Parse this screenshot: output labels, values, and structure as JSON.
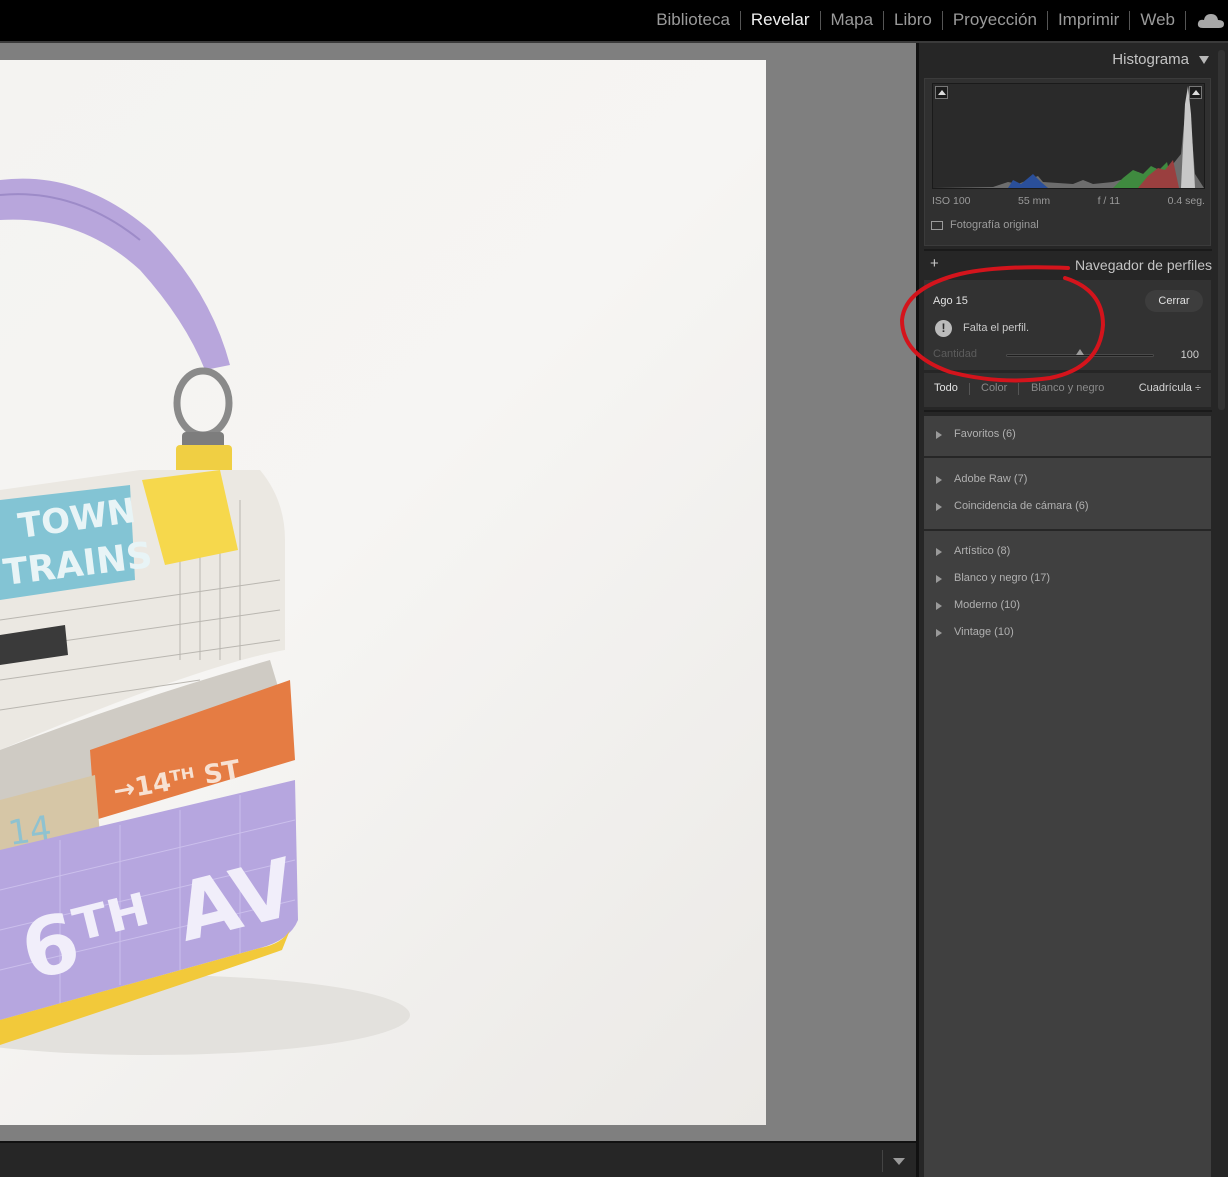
{
  "topbar": {
    "modules": [
      "Biblioteca",
      "Revelar",
      "Mapa",
      "Libro",
      "Proyección",
      "Imprimir",
      "Web"
    ],
    "active_module": "Revelar"
  },
  "histogram": {
    "title": "Histograma",
    "iso": "ISO 100",
    "focal": "55 mm",
    "aperture": "f / 11",
    "shutter": "0.4 seg.",
    "original_photo_label": "Fotografía original"
  },
  "profile_browser": {
    "title": "Navegador de perfiles",
    "profile_name": "Ago 15",
    "close_label": "Cerrar",
    "warning": "Falta el perfil.",
    "amount_label": "Cantidad",
    "amount_value": "100",
    "amount_fraction": 0.5,
    "filters": [
      "Todo",
      "Color",
      "Blanco y negro"
    ],
    "active_filter": "Todo",
    "view_mode": "Cuadrícula ÷",
    "groups": [
      [
        "Favoritos (6)"
      ],
      [
        "Adobe Raw (7)",
        "Coincidencia de cámara (6)"
      ],
      [
        "Artístico (8)",
        "Blanco y negro (17)",
        "Moderno (10)",
        "Vintage (10)"
      ]
    ]
  },
  "colors": {
    "annotation": "#d4141c",
    "active_text": "#f0f0f0",
    "inactive_text": "#9a9a9a"
  }
}
